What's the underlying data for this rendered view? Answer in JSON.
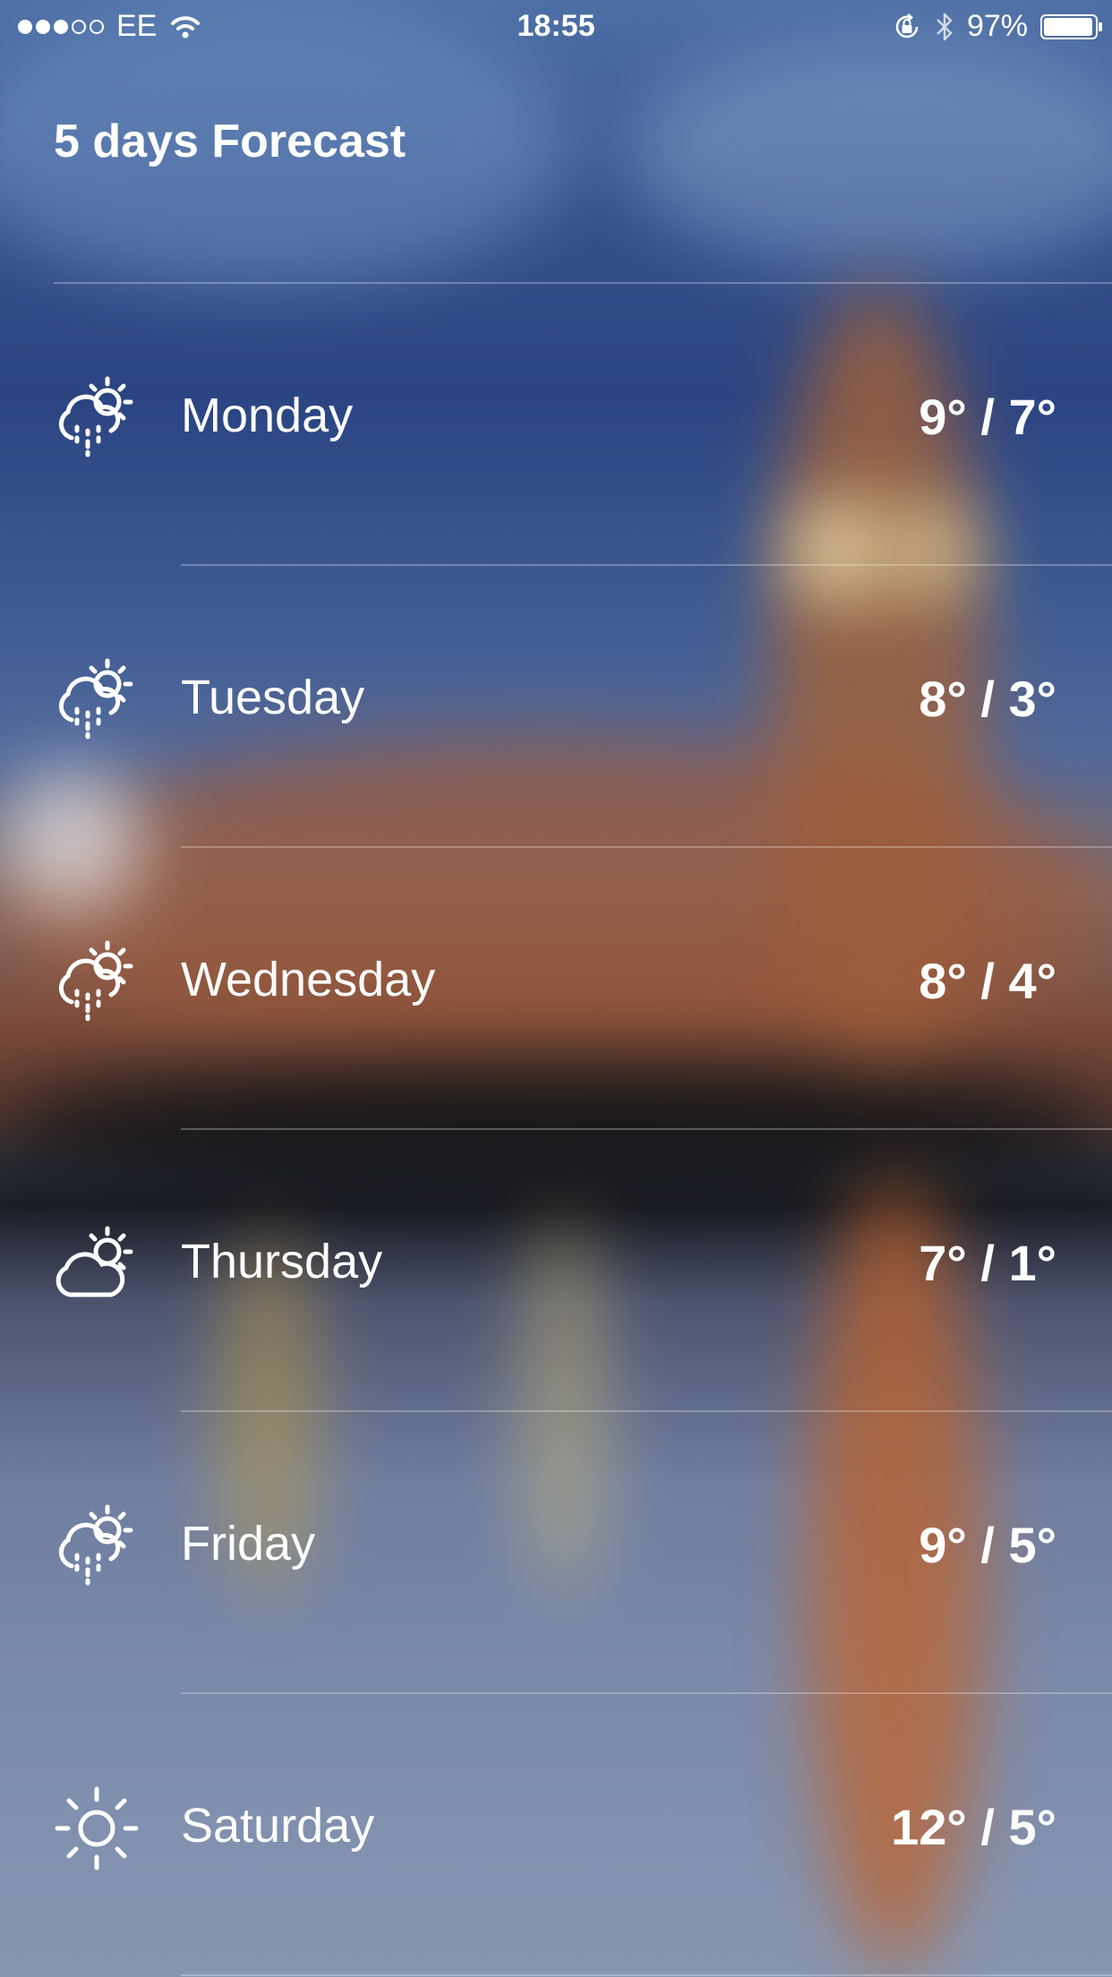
{
  "status_bar": {
    "carrier": "EE",
    "time": "18:55",
    "battery_percent": "97%",
    "battery_level": 0.97,
    "signal_bars": 3,
    "signal_total": 5
  },
  "header": {
    "title": "5 days Forecast"
  },
  "forecast": [
    {
      "day": "Monday",
      "temp": "9° / 7°",
      "icon": "rain-sun-icon"
    },
    {
      "day": "Tuesday",
      "temp": "8° / 3°",
      "icon": "rain-sun-icon"
    },
    {
      "day": "Wednesday",
      "temp": "8° / 4°",
      "icon": "rain-sun-icon"
    },
    {
      "day": "Thursday",
      "temp": "7° / 1°",
      "icon": "partly-cloudy-icon"
    },
    {
      "day": "Friday",
      "temp": "9° / 5°",
      "icon": "rain-sun-icon"
    },
    {
      "day": "Saturday",
      "temp": "12° / 5°",
      "icon": "sun-icon"
    }
  ]
}
